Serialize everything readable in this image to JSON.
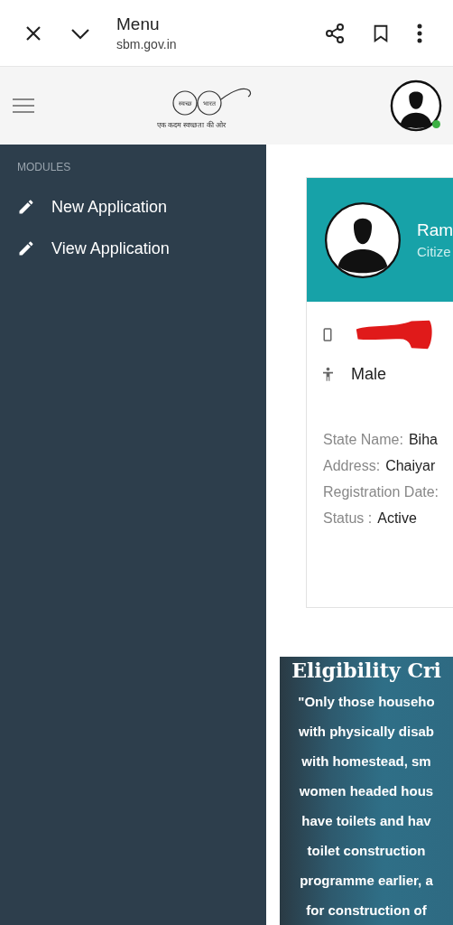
{
  "browser_bar": {
    "title": "Menu",
    "url": "sbm.gov.in"
  },
  "header": {
    "logo": {
      "word_1": "स्वच्छ",
      "word_2": "भारत",
      "tagline": "एक कदम स्वच्छता की ओर"
    },
    "avatar": {
      "online": true
    }
  },
  "sidebar": {
    "section": "MODULES",
    "items": [
      {
        "label": "New Application"
      },
      {
        "label": "View Application"
      }
    ]
  },
  "profile_card": {
    "name": "Ram",
    "role": "Citize",
    "phone_redacted": true,
    "gender": "Male",
    "details": [
      {
        "label": "State Name:",
        "value": "Biha"
      },
      {
        "label": "Address:",
        "value": "Chaiyar"
      },
      {
        "label": "Registration Date:"
      },
      {
        "label": "Status :",
        "value": "Active"
      }
    ]
  },
  "eligibility": {
    "title": "Eligibility Cri",
    "lines": [
      "\"Only those househo",
      "with physically disab",
      "with homestead, sm",
      "women headed hous",
      "have toilets and hav",
      "toilet construction",
      "programme earlier, a",
      "for construction of"
    ]
  }
}
